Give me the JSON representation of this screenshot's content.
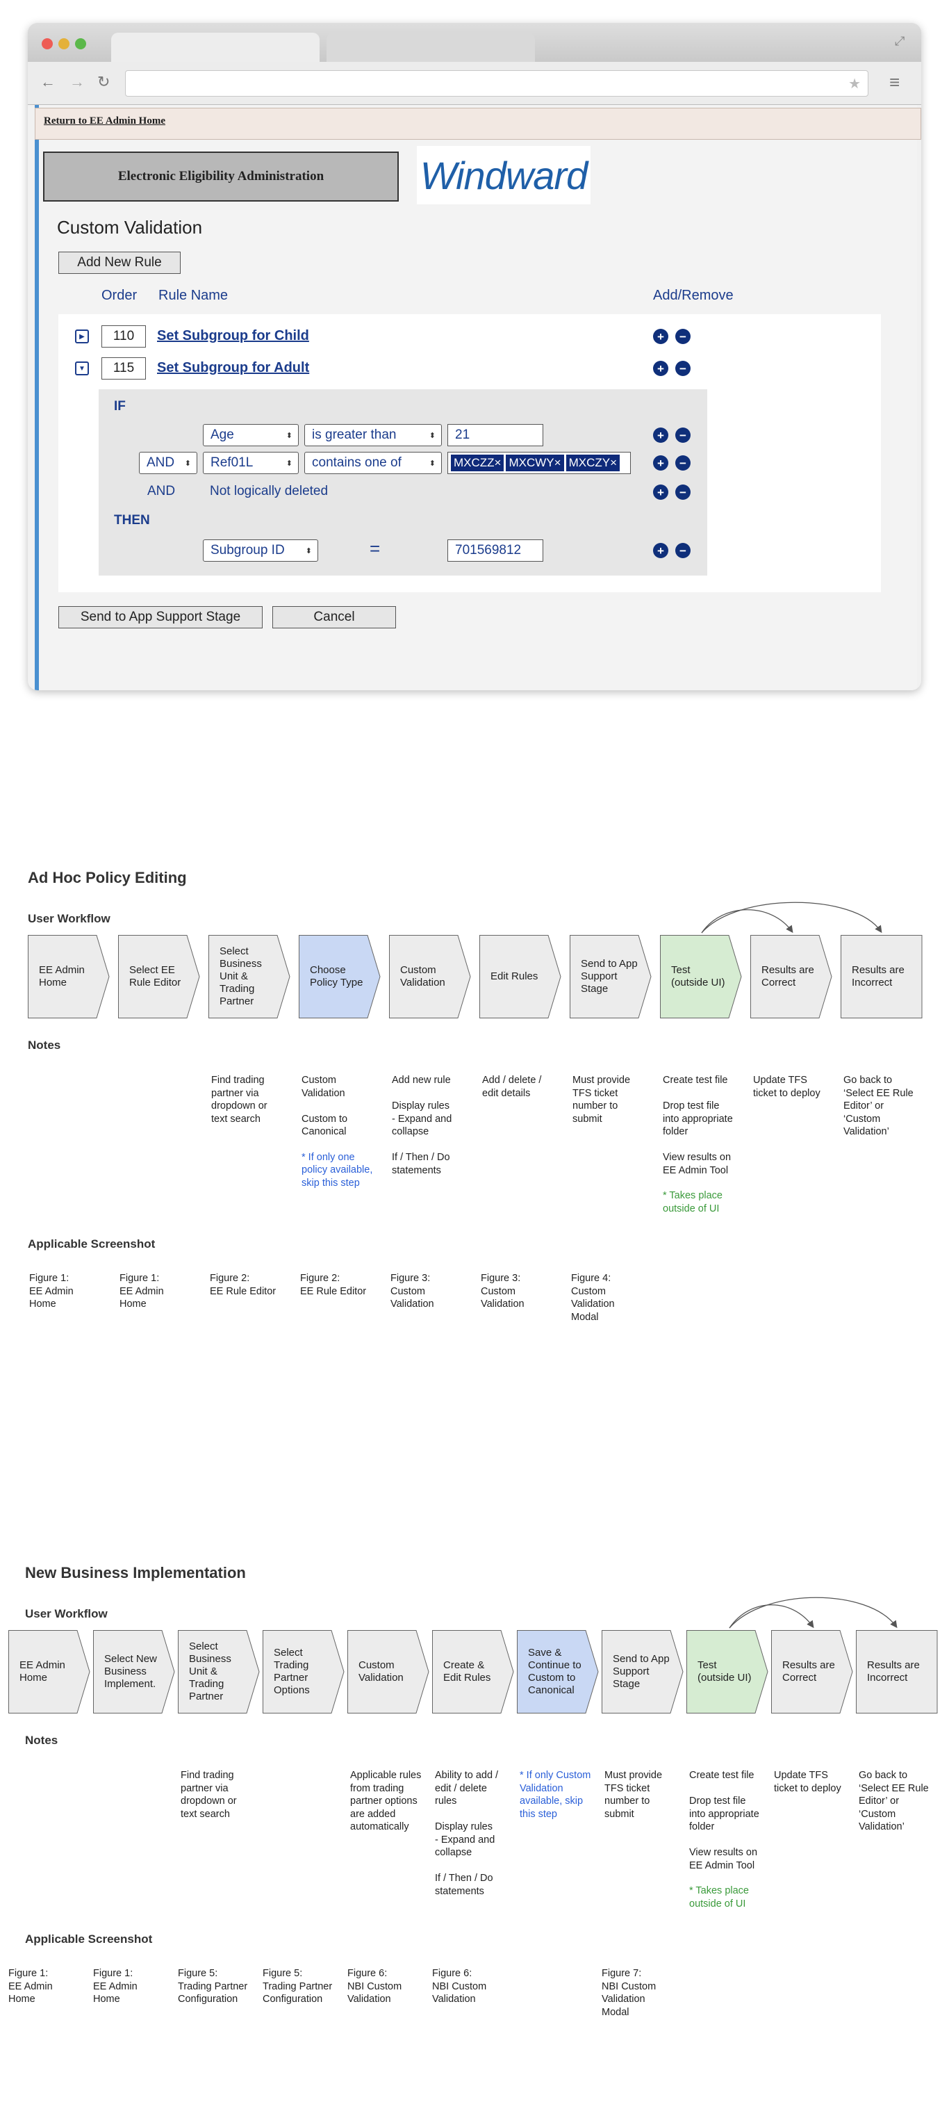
{
  "browser": {
    "back_icon": "back-arrow-icon",
    "forward_icon": "forward-arrow-icon",
    "reload_icon": "reload-icon",
    "star_icon": "star-icon",
    "menu_icon": "hamburger-menu-icon",
    "url": ""
  },
  "app": {
    "return_link": "Return to EE Admin Home",
    "banner_title": "Electronic Eligibility Administration",
    "logo_text": "Windward",
    "page_title": "Custom Validation",
    "add_rule_button": "Add New Rule",
    "columns": {
      "order": "Order",
      "rule_name": "Rule Name",
      "add_remove": "Add/Remove"
    },
    "rules": [
      {
        "order": "110",
        "name": "Set Subgroup for Child",
        "expanded": false
      },
      {
        "order": "115",
        "name": "Set Subgroup for Adult",
        "expanded": true
      }
    ],
    "if_label": "IF",
    "then_label": "THEN",
    "conditions": [
      {
        "connector": "",
        "field": "Age",
        "operator": "is greater than",
        "value": "21"
      },
      {
        "connector": "AND",
        "field": "Ref01L",
        "operator": "contains one of",
        "chips": [
          "MXCZZ",
          "MXCWY",
          "MXCZY"
        ]
      },
      {
        "connector": "AND",
        "text": "Not logically deleted"
      }
    ],
    "then_action": {
      "field": "Subgroup ID",
      "operator": "=",
      "value": "701569812"
    },
    "send_button": "Send to App Support Stage",
    "cancel_button": "Cancel"
  },
  "workflows": [
    {
      "title": "Ad Hoc Policy Editing",
      "user_workflow_label": "User Workflow",
      "notes_label": "Notes",
      "screenshot_label": "Applicable Screenshot",
      "steps": [
        {
          "label": "EE Admin\nHome",
          "color": "#ececec"
        },
        {
          "label": "Select EE\nRule Editor",
          "color": "#ececec"
        },
        {
          "label": "Select\nBusiness\nUnit &\nTrading\nPartner",
          "color": "#ececec"
        },
        {
          "label": "Choose\nPolicy Type",
          "color": "#c9d8f4"
        },
        {
          "label": "Custom\nValidation",
          "color": "#ececec"
        },
        {
          "label": "Edit Rules",
          "color": "#ececec"
        },
        {
          "label": "Send to App\nSupport\nStage",
          "color": "#ececec"
        },
        {
          "label": "Test\n(outside UI)",
          "color": "#d6ecd2"
        },
        {
          "label": "Results are\nCorrect",
          "color": "#ececec"
        },
        {
          "label": "Results are\nIncorrect",
          "color": "#ececec",
          "last": true
        }
      ],
      "notes": [
        "",
        "",
        "Find trading\npartner via\ndropdown or\ntext search",
        "Custom\nValidation\n\nCustom to\nCanonical",
        "Add new rule\n\nDisplay rules\n  - Expand and\n    collapse\n\nIf / Then / Do\nstatements",
        "Add / delete /\nedit details",
        "Must provide\nTFS ticket\nnumber to\nsubmit",
        "Create test file\n\nDrop test file\ninto appropriate\nfolder\n\nView results on\nEE Admin Tool",
        "Update TFS\nticket to deploy",
        "Go back to\n‘Select EE Rule\nEditor’ or\n‘Custom\nValidation’"
      ],
      "note_extras": [
        {
          "step": 3,
          "text": "* If only one\npolicy available,\nskip this step",
          "color": "blue"
        },
        {
          "step": 7,
          "text": "* Takes place\noutside of UI",
          "color": "green"
        }
      ],
      "figures": [
        "Figure 1:\nEE Admin\nHome",
        "Figure 1:\nEE Admin\nHome",
        "Figure 2:\nEE Rule Editor",
        "Figure 2:\nEE Rule Editor",
        "Figure 3:\nCustom\nValidation",
        "Figure 3:\nCustom\nValidation",
        "Figure 4:\nCustom\nValidation\nModal"
      ]
    },
    {
      "title": "New Business Implementation",
      "user_workflow_label": "User Workflow",
      "notes_label": "Notes",
      "screenshot_label": "Applicable Screenshot",
      "steps": [
        {
          "label": "EE Admin\nHome",
          "color": "#ececec"
        },
        {
          "label": "Select New\nBusiness\nImplement.",
          "color": "#ececec"
        },
        {
          "label": "Select\nBusiness\nUnit &\nTrading\nPartner",
          "color": "#ececec"
        },
        {
          "label": "Select\nTrading\nPartner\nOptions",
          "color": "#ececec"
        },
        {
          "label": "Custom\nValidation",
          "color": "#ececec"
        },
        {
          "label": "Create &\nEdit Rules",
          "color": "#ececec"
        },
        {
          "label": "Save &\nContinue to\nCustom to\nCanonical",
          "color": "#c9d8f4"
        },
        {
          "label": "Send to App\nSupport\nStage",
          "color": "#ececec"
        },
        {
          "label": "Test\n(outside UI)",
          "color": "#d6ecd2"
        },
        {
          "label": "Results are\nCorrect",
          "color": "#ececec"
        },
        {
          "label": "Results are\nIncorrect",
          "color": "#ececec",
          "last": true
        }
      ],
      "notes": [
        "",
        "",
        "Find trading\npartner via\ndropdown or\ntext search",
        "",
        "Applicable rules\nfrom trading\npartner options\nare added\nautomatically",
        "Ability to add /\nedit / delete\nrules\n\nDisplay rules\n  - Expand and\n    collapse\n\nIf / Then / Do\nstatements",
        "",
        "Must provide\nTFS ticket\nnumber to\nsubmit",
        "Create test file\n\nDrop test file\ninto appropriate\nfolder\n\nView results on\nEE Admin Tool",
        "Update TFS\nticket to deploy",
        "Go back to\n‘Select EE Rule\nEditor’ or\n‘Custom\nValidation’"
      ],
      "note_extras": [
        {
          "step": 6,
          "text": "* If only Custom\nValidation\navailable, skip\nthis step",
          "color": "blue"
        },
        {
          "step": 8,
          "text": "* Takes place\noutside of UI",
          "color": "green"
        }
      ],
      "figures": [
        "Figure 1:\nEE Admin\nHome",
        "Figure 1:\nEE Admin\nHome",
        "Figure 5:\nTrading Partner\nConfiguration",
        "Figure 5:\nTrading Partner\nConfiguration",
        "Figure 6:\nNBI Custom\nValidation",
        "Figure 6:\nNBI Custom\nValidation",
        "",
        "Figure 7:\nNBI Custom\nValidation\nModal"
      ]
    }
  ]
}
